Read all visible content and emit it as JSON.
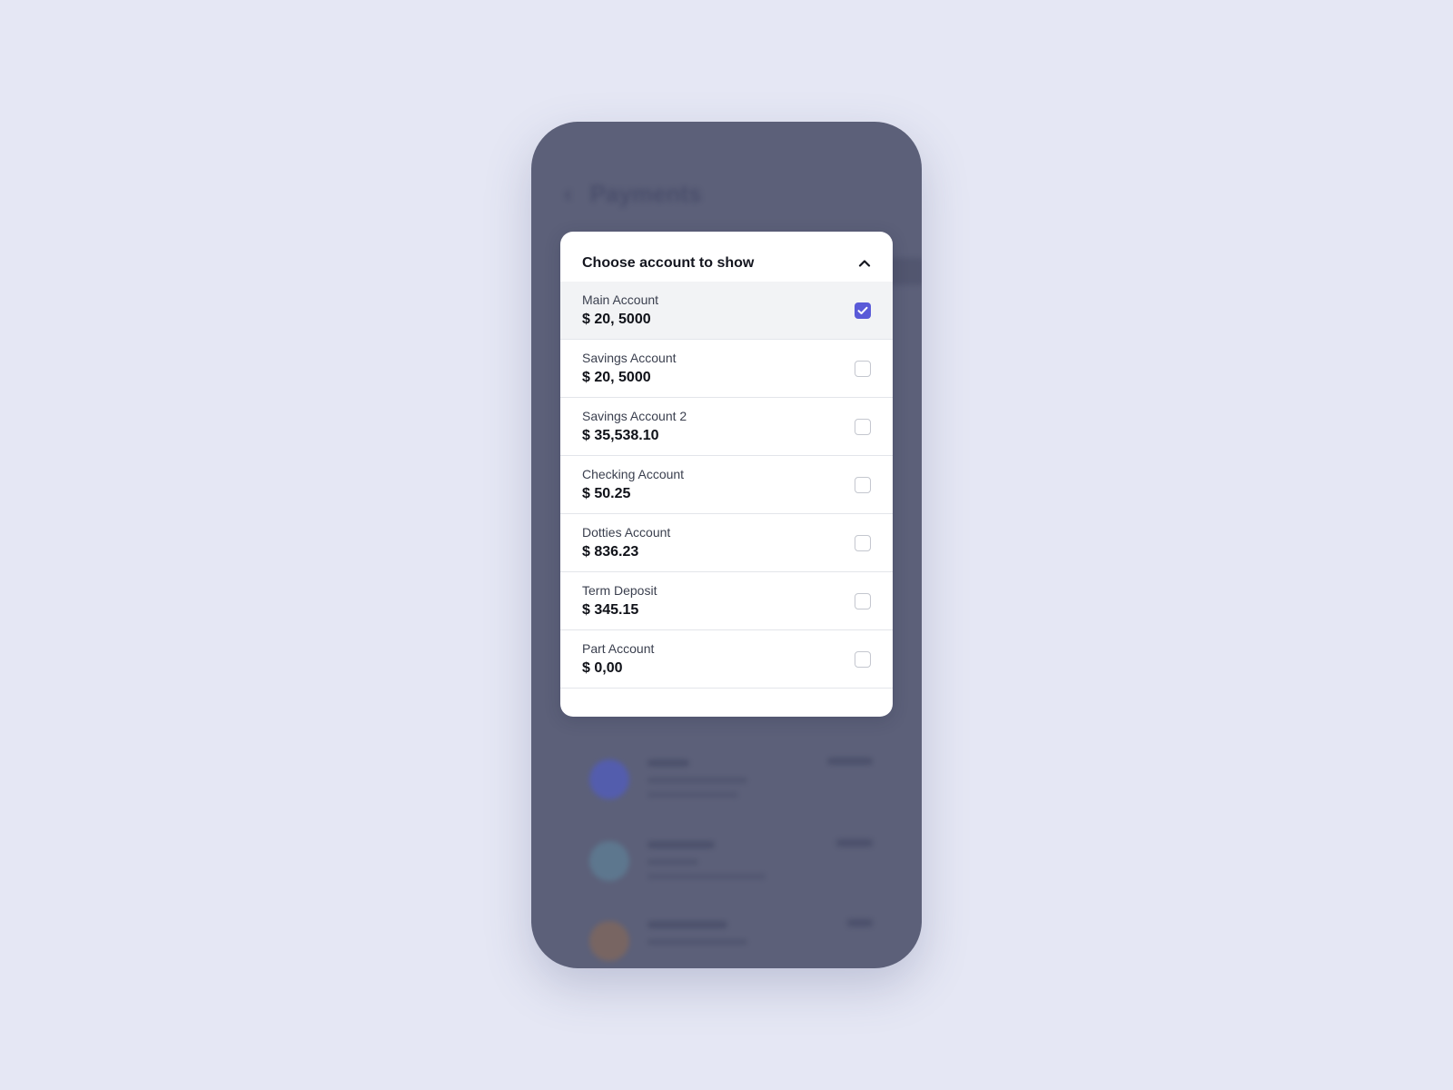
{
  "background_app": {
    "title": "Payments"
  },
  "dropdown": {
    "title": "Choose account to show",
    "accent_color": "#5a5ad8",
    "accounts": [
      {
        "name": "Main Account",
        "balance": "$ 20, 5000",
        "checked": true
      },
      {
        "name": "Savings Account",
        "balance": "$ 20, 5000",
        "checked": false
      },
      {
        "name": "Savings Account 2",
        "balance": "$ 35,538.10",
        "checked": false
      },
      {
        "name": "Checking Account",
        "balance": "$ 50.25",
        "checked": false
      },
      {
        "name": "Dotties Account",
        "balance": "$ 836.23",
        "checked": false
      },
      {
        "name": "Term Deposit",
        "balance": "$ 345.15",
        "checked": false
      },
      {
        "name": "Part Account",
        "balance": "$ 0,00",
        "checked": false
      }
    ]
  }
}
